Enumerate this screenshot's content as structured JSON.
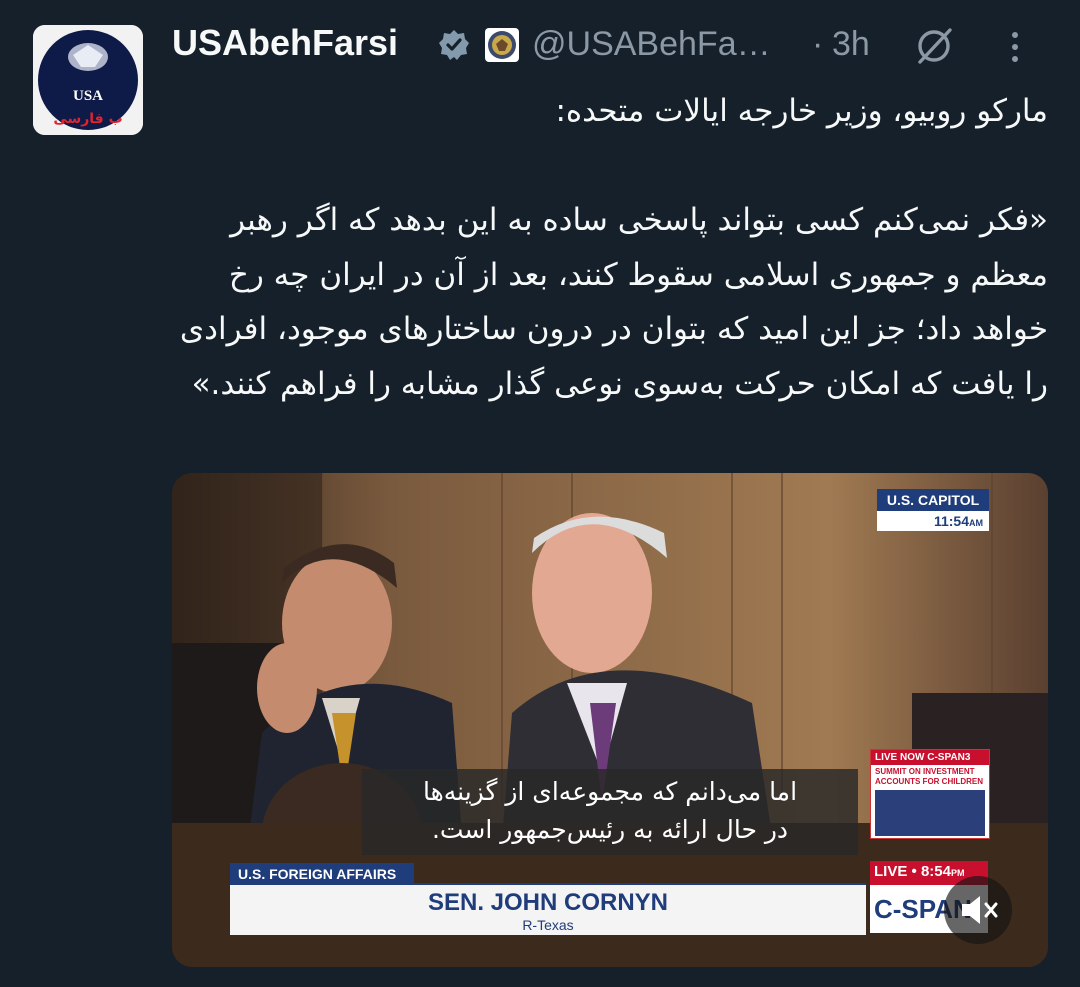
{
  "tweet": {
    "author_name": "USAbehFarsi",
    "handle": "@USABehFa…",
    "separator": "·",
    "time": "3h",
    "avatar_text_top": "USA",
    "avatar_text_bottom": "ب فارسی",
    "text": "مارکو روبیو، وزیر خارجه ایالات متحده:\n\n«فکر نمی‌کنم کسی بتواند پاسخی ساده به این بدهد که اگر رهبر معظم و جمهوری اسلامی سقوط کنند، بعد از آن در ایران چه رخ خواهد داد؛ جز این امید که بتوان در درون ساختارهای موجود، افرادی را یافت که امکان حرکت به‌سوی نوعی گذار مشابه را فراهم کنند.»"
  },
  "video": {
    "location_label": "U.S. CAPITOL",
    "location_time": "11:54",
    "location_time_suffix": "AM",
    "live_now_label": "LIVE NOW C-SPAN3",
    "live_now_title": "SUMMIT ON INVESTMENT ACCOUNTS FOR CHILDREN",
    "subtitle_line1": "اما می‌دانم که مجموعه‌ای از گزینه‌ها",
    "subtitle_line2": "در حال ارائه به رئیس‌جمهور است.",
    "program_tag": "U.S. FOREIGN AFFAIRS",
    "speaker_name": "SEN. JOHN CORNYN",
    "speaker_sub": "R-Texas",
    "live_label": "LIVE",
    "live_time": "8:54",
    "live_time_suffix": "PM",
    "network_logo": "C-SPAN"
  },
  "icons": {
    "verified": "verified-badge-icon",
    "affiliation": "state-department-seal-icon",
    "grok": "grok-icon",
    "more": "more-options-icon",
    "mute": "mute-icon"
  },
  "colors": {
    "background": "#15202b",
    "text": "#e7e9ea",
    "secondary": "#8b98a5",
    "verified": "#829aab",
    "cspan_blue": "#1f3d7a",
    "cspan_red": "#c8102e"
  }
}
